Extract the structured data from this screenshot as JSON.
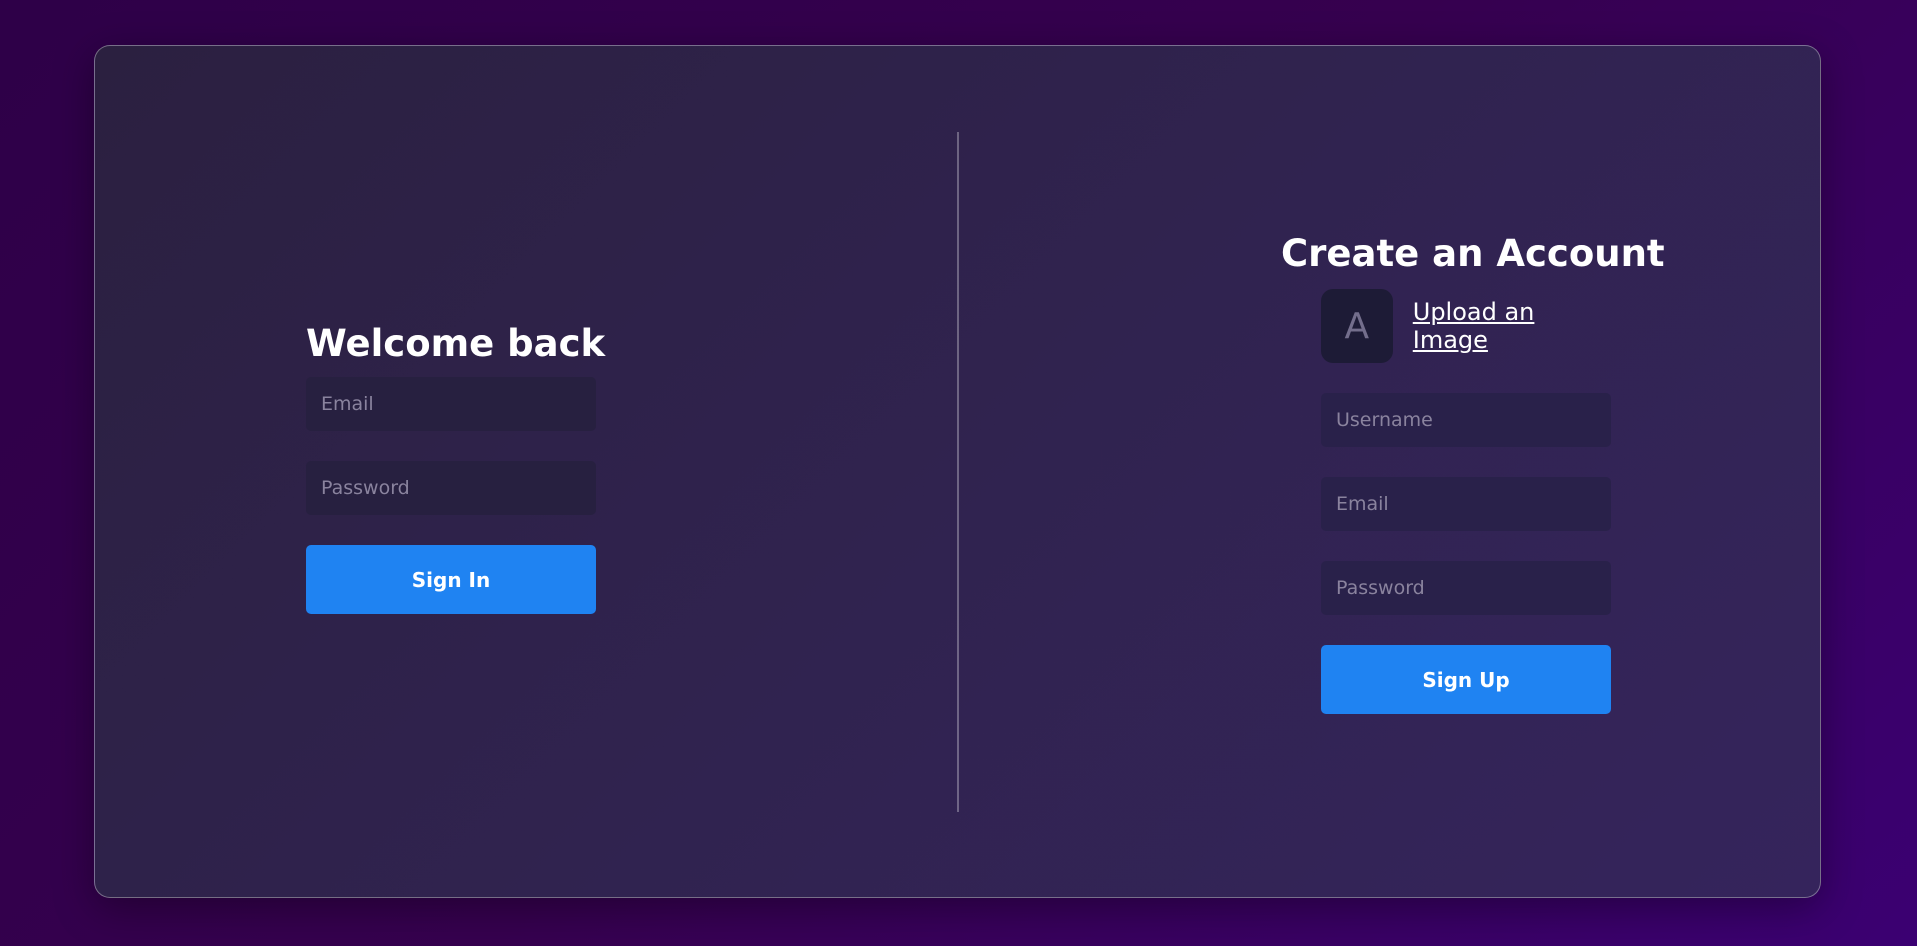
{
  "signin": {
    "title": "Welcome back",
    "email_placeholder": "Email",
    "password_placeholder": "Password",
    "button_label": "Sign In"
  },
  "signup": {
    "title": "Create an Account",
    "avatar_initial": "A",
    "upload_label": "Upload an Image",
    "username_placeholder": "Username",
    "email_placeholder": "Email",
    "password_placeholder": "Password",
    "button_label": "Sign Up"
  },
  "colors": {
    "accent": "#1f83f2",
    "card_background": "#30234f",
    "page_background": "#36004f",
    "input_background": "#272040"
  }
}
